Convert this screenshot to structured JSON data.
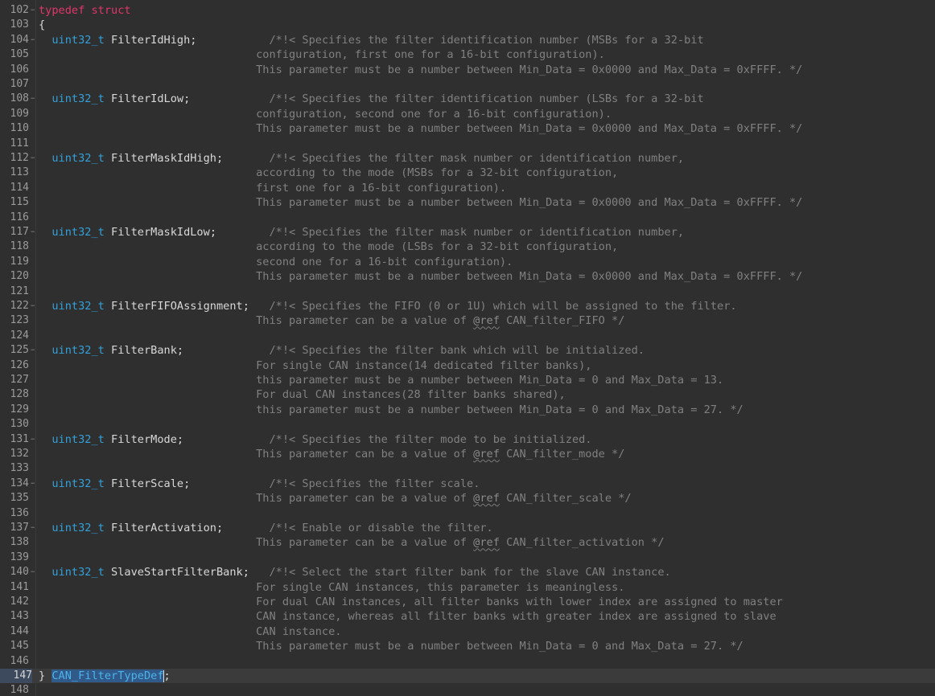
{
  "editor": {
    "lines": [
      {
        "n": "102",
        "fold": true,
        "parts": [
          {
            "t": "typedef struct",
            "c": "kw"
          }
        ]
      },
      {
        "n": "103",
        "fold": false,
        "parts": [
          {
            "t": "{",
            "c": "brace"
          }
        ]
      },
      {
        "n": "104",
        "fold": true,
        "parts": [
          {
            "t": "  "
          },
          {
            "t": "uint32_t",
            "c": "type"
          },
          {
            "t": " FilterIdHigh",
            "c": "field"
          },
          {
            "t": ";           "
          },
          {
            "t": "/*!< Specifies the filter identification number (MSBs for a 32-bit",
            "c": "cm"
          }
        ]
      },
      {
        "n": "105",
        "fold": false,
        "parts": [
          {
            "t": "                                 configuration, first one for a 16-bit configuration).",
            "c": "cm"
          }
        ]
      },
      {
        "n": "106",
        "fold": false,
        "parts": [
          {
            "t": "                                 This parameter must be a number between Min_Data = 0x0000 and Max_Data = 0xFFFF. */",
            "c": "cm"
          }
        ]
      },
      {
        "n": "107",
        "fold": false,
        "parts": []
      },
      {
        "n": "108",
        "fold": true,
        "parts": [
          {
            "t": "  "
          },
          {
            "t": "uint32_t",
            "c": "type"
          },
          {
            "t": " FilterIdLow",
            "c": "field"
          },
          {
            "t": ";            "
          },
          {
            "t": "/*!< Specifies the filter identification number (LSBs for a 32-bit",
            "c": "cm"
          }
        ]
      },
      {
        "n": "109",
        "fold": false,
        "parts": [
          {
            "t": "                                 configuration, second one for a 16-bit configuration).",
            "c": "cm"
          }
        ]
      },
      {
        "n": "110",
        "fold": false,
        "parts": [
          {
            "t": "                                 This parameter must be a number between Min_Data = 0x0000 and Max_Data = 0xFFFF. */",
            "c": "cm"
          }
        ]
      },
      {
        "n": "111",
        "fold": false,
        "parts": []
      },
      {
        "n": "112",
        "fold": true,
        "parts": [
          {
            "t": "  "
          },
          {
            "t": "uint32_t",
            "c": "type"
          },
          {
            "t": " FilterMaskIdHigh",
            "c": "field"
          },
          {
            "t": ";       "
          },
          {
            "t": "/*!< Specifies the filter mask number or identification number,",
            "c": "cm"
          }
        ]
      },
      {
        "n": "113",
        "fold": false,
        "parts": [
          {
            "t": "                                 according to the mode (MSBs for a 32-bit configuration,",
            "c": "cm"
          }
        ]
      },
      {
        "n": "114",
        "fold": false,
        "parts": [
          {
            "t": "                                 first one for a 16-bit configuration).",
            "c": "cm"
          }
        ]
      },
      {
        "n": "115",
        "fold": false,
        "parts": [
          {
            "t": "                                 This parameter must be a number between Min_Data = 0x0000 and Max_Data = 0xFFFF. */",
            "c": "cm"
          }
        ]
      },
      {
        "n": "116",
        "fold": false,
        "parts": []
      },
      {
        "n": "117",
        "fold": true,
        "parts": [
          {
            "t": "  "
          },
          {
            "t": "uint32_t",
            "c": "type"
          },
          {
            "t": " FilterMaskIdLow",
            "c": "field"
          },
          {
            "t": ";        "
          },
          {
            "t": "/*!< Specifies the filter mask number or identification number,",
            "c": "cm"
          }
        ]
      },
      {
        "n": "118",
        "fold": false,
        "parts": [
          {
            "t": "                                 according to the mode (LSBs for a 32-bit configuration,",
            "c": "cm"
          }
        ]
      },
      {
        "n": "119",
        "fold": false,
        "parts": [
          {
            "t": "                                 second one for a 16-bit configuration).",
            "c": "cm"
          }
        ]
      },
      {
        "n": "120",
        "fold": false,
        "parts": [
          {
            "t": "                                 This parameter must be a number between Min_Data = 0x0000 and Max_Data = 0xFFFF. */",
            "c": "cm"
          }
        ]
      },
      {
        "n": "121",
        "fold": false,
        "parts": []
      },
      {
        "n": "122",
        "fold": true,
        "parts": [
          {
            "t": "  "
          },
          {
            "t": "uint32_t",
            "c": "type"
          },
          {
            "t": " FilterFIFOAssignment",
            "c": "field"
          },
          {
            "t": ";   "
          },
          {
            "t": "/*!< Specifies the FIFO (0 or 1U) which will be assigned to the filter.",
            "c": "cm"
          }
        ]
      },
      {
        "n": "123",
        "fold": false,
        "parts": [
          {
            "t": "                                 This parameter can be a value of ",
            "c": "cm"
          },
          {
            "t": "@ref",
            "c": "ref"
          },
          {
            "t": " CAN_filter_FIFO */",
            "c": "cm"
          }
        ]
      },
      {
        "n": "124",
        "fold": false,
        "parts": []
      },
      {
        "n": "125",
        "fold": true,
        "parts": [
          {
            "t": "  "
          },
          {
            "t": "uint32_t",
            "c": "type"
          },
          {
            "t": " FilterBank",
            "c": "field"
          },
          {
            "t": ";             "
          },
          {
            "t": "/*!< Specifies the filter bank which will be initialized.",
            "c": "cm"
          }
        ]
      },
      {
        "n": "126",
        "fold": false,
        "parts": [
          {
            "t": "                                 For single CAN instance(14 dedicated filter banks),",
            "c": "cm"
          }
        ]
      },
      {
        "n": "127",
        "fold": false,
        "parts": [
          {
            "t": "                                 this parameter must be a number between Min_Data = 0 and Max_Data = 13.",
            "c": "cm"
          }
        ]
      },
      {
        "n": "128",
        "fold": false,
        "parts": [
          {
            "t": "                                 For dual CAN instances(28 filter banks shared),",
            "c": "cm"
          }
        ]
      },
      {
        "n": "129",
        "fold": false,
        "parts": [
          {
            "t": "                                 this parameter must be a number between Min_Data = 0 and Max_Data = 27. */",
            "c": "cm"
          }
        ]
      },
      {
        "n": "130",
        "fold": false,
        "parts": []
      },
      {
        "n": "131",
        "fold": true,
        "parts": [
          {
            "t": "  "
          },
          {
            "t": "uint32_t",
            "c": "type"
          },
          {
            "t": " FilterMode",
            "c": "field"
          },
          {
            "t": ";             "
          },
          {
            "t": "/*!< Specifies the filter mode to be initialized.",
            "c": "cm"
          }
        ]
      },
      {
        "n": "132",
        "fold": false,
        "parts": [
          {
            "t": "                                 This parameter can be a value of ",
            "c": "cm"
          },
          {
            "t": "@ref",
            "c": "ref"
          },
          {
            "t": " CAN_filter_mode */",
            "c": "cm"
          }
        ]
      },
      {
        "n": "133",
        "fold": false,
        "parts": []
      },
      {
        "n": "134",
        "fold": true,
        "parts": [
          {
            "t": "  "
          },
          {
            "t": "uint32_t",
            "c": "type"
          },
          {
            "t": " FilterScale",
            "c": "field"
          },
          {
            "t": ";            "
          },
          {
            "t": "/*!< Specifies the filter scale.",
            "c": "cm"
          }
        ]
      },
      {
        "n": "135",
        "fold": false,
        "parts": [
          {
            "t": "                                 This parameter can be a value of ",
            "c": "cm"
          },
          {
            "t": "@ref",
            "c": "ref"
          },
          {
            "t": " CAN_filter_scale */",
            "c": "cm"
          }
        ]
      },
      {
        "n": "136",
        "fold": false,
        "parts": []
      },
      {
        "n": "137",
        "fold": true,
        "parts": [
          {
            "t": "  "
          },
          {
            "t": "uint32_t",
            "c": "type"
          },
          {
            "t": " FilterActivation",
            "c": "field"
          },
          {
            "t": ";       "
          },
          {
            "t": "/*!< Enable or disable the filter.",
            "c": "cm"
          }
        ]
      },
      {
        "n": "138",
        "fold": false,
        "parts": [
          {
            "t": "                                 This parameter can be a value of ",
            "c": "cm"
          },
          {
            "t": "@ref",
            "c": "ref"
          },
          {
            "t": " CAN_filter_activation */",
            "c": "cm"
          }
        ]
      },
      {
        "n": "139",
        "fold": false,
        "parts": []
      },
      {
        "n": "140",
        "fold": true,
        "parts": [
          {
            "t": "  "
          },
          {
            "t": "uint32_t",
            "c": "type"
          },
          {
            "t": " SlaveStartFilterBank",
            "c": "field"
          },
          {
            "t": ";   "
          },
          {
            "t": "/*!< Select the start filter bank for the slave CAN instance.",
            "c": "cm"
          }
        ]
      },
      {
        "n": "141",
        "fold": false,
        "parts": [
          {
            "t": "                                 For single CAN instances, this parameter is meaningless.",
            "c": "cm"
          }
        ]
      },
      {
        "n": "142",
        "fold": false,
        "parts": [
          {
            "t": "                                 For dual CAN instances, all filter banks with lower index are assigned to master",
            "c": "cm"
          }
        ]
      },
      {
        "n": "143",
        "fold": false,
        "parts": [
          {
            "t": "                                 CAN instance, whereas all filter banks with greater index are assigned to slave",
            "c": "cm"
          }
        ]
      },
      {
        "n": "144",
        "fold": false,
        "parts": [
          {
            "t": "                                 CAN instance.",
            "c": "cm"
          }
        ]
      },
      {
        "n": "145",
        "fold": false,
        "parts": [
          {
            "t": "                                 This parameter must be a number between Min_Data = 0 and Max_Data = 27. */",
            "c": "cm"
          }
        ]
      },
      {
        "n": "146",
        "fold": false,
        "parts": []
      },
      {
        "n": "147",
        "fold": false,
        "current": true,
        "parts": [
          {
            "t": "} ",
            "c": "brace"
          },
          {
            "t": "CAN_FilterTypeDef",
            "c": "sel"
          },
          {
            "t": "|",
            "c": "caret"
          },
          {
            "t": ";",
            "c": "semi"
          }
        ]
      },
      {
        "n": "148",
        "fold": false,
        "parts": []
      }
    ]
  },
  "colors": {
    "background": "#2f2f2f",
    "keyword": "#e0366a",
    "type": "#33a0d8",
    "comment": "#808080",
    "selection": "#2f5a8a",
    "current_line": "#3b3b3b"
  }
}
